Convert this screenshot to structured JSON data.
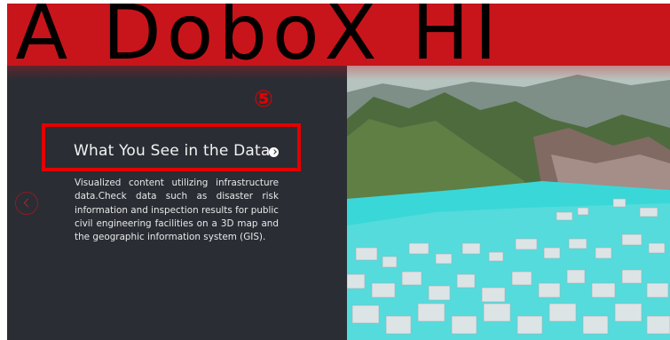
{
  "banner": {
    "text": "IA DoboX HI"
  },
  "step_marker": "⑤",
  "section": {
    "title": "What You See in the Data",
    "description": "Visualized content utilizing infrastructure data.Check data such as disaster risk information and inspection results for public civil engineering facilities on a 3D map and the geographic information system (GIS)."
  },
  "icons": {
    "prev": "chevron-left-circle-icon",
    "title_arrow": "chevron-right-dot-icon"
  },
  "colors": {
    "banner": "#c8151b",
    "panel": "#2a2d34",
    "highlight": "#e30000",
    "water": "#3ad7d8"
  }
}
